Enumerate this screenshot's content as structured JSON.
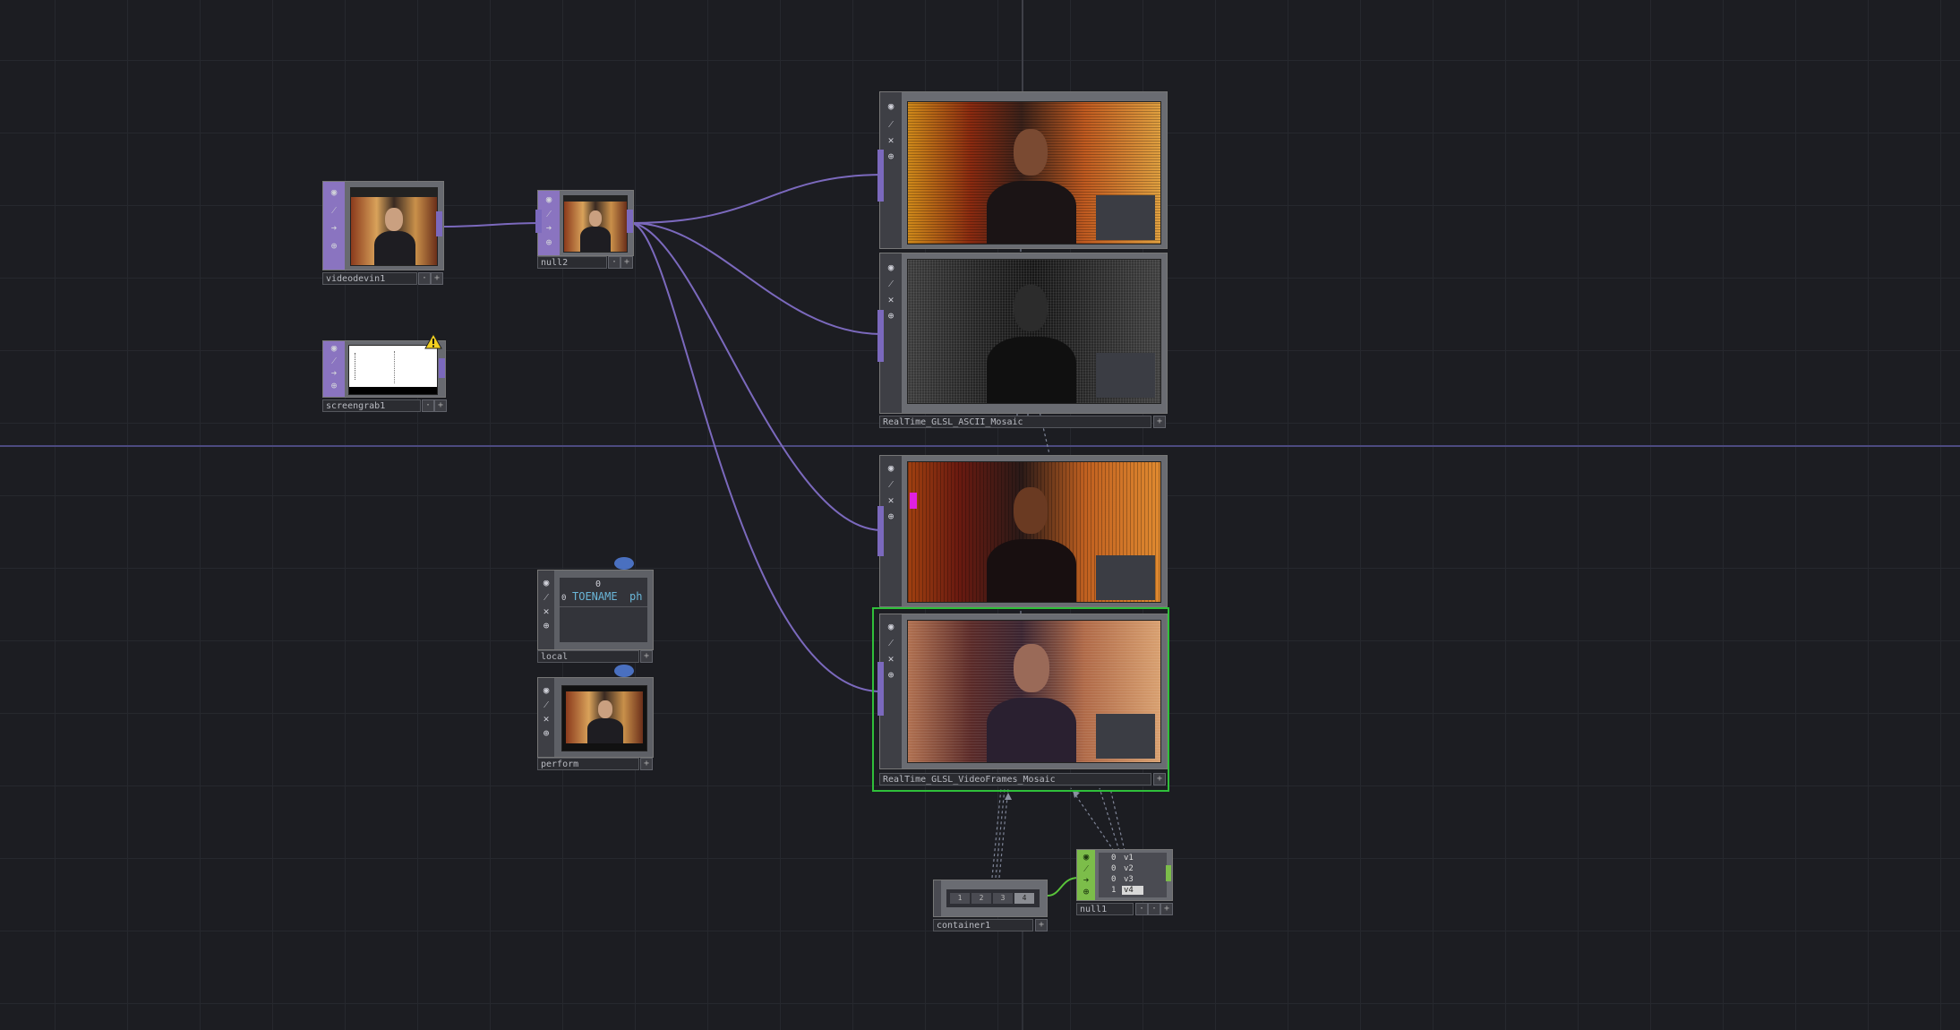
{
  "nodes": {
    "videodevin": {
      "label": "videodevin1"
    },
    "null2": {
      "label": "null2"
    },
    "screengrab": {
      "label": "screengrab1"
    },
    "local": {
      "label": "local",
      "table_index": "0",
      "row_index": "0",
      "cell_name": "TOENAME",
      "cell_value": "ph"
    },
    "perform": {
      "label": "perform"
    },
    "ascii_mosaic": {
      "label": "RealTime_GLSL_ASCII_Mosaic"
    },
    "videoframes_mosaic": {
      "label": "RealTime_GLSL_VideoFrames_Mosaic"
    },
    "container1": {
      "label": "container1",
      "buttons": [
        "1",
        "2",
        "3",
        "4"
      ]
    },
    "null1": {
      "label": "null1",
      "channels": [
        {
          "value": "0",
          "name": "v1"
        },
        {
          "value": "0",
          "name": "v2"
        },
        {
          "value": "0",
          "name": "v3"
        },
        {
          "value": "1",
          "name": "v4"
        }
      ]
    }
  },
  "icons": {
    "viewer": "eye-icon",
    "bypass": "pin-icon",
    "cook": "arrow-icon",
    "lock": "lock-icon",
    "warning": "warning-icon",
    "comment": "comment-bubble-icon"
  },
  "colors": {
    "background": "#1c1d22",
    "wire": "#7b69bd",
    "selected": "#2fbf3a",
    "chop": "#7cbd4a",
    "top": "#8a74c0",
    "warning": "#f2cf1f"
  }
}
